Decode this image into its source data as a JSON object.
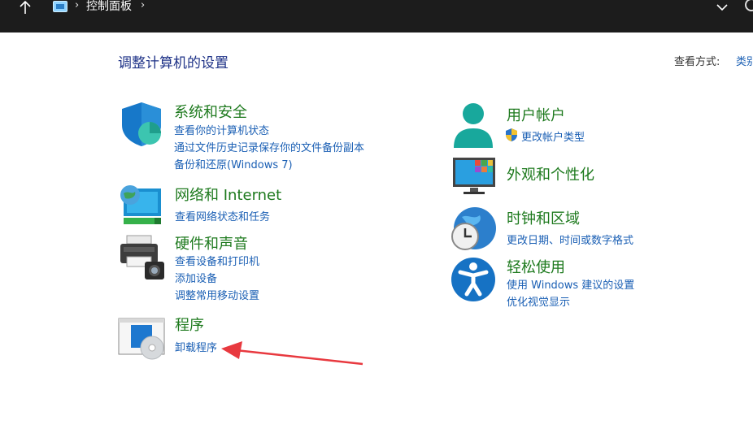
{
  "address_bar": {
    "up_icon": "up-arrow-icon",
    "location_icon": "control-panel-icon",
    "crumb": "控制面板"
  },
  "page": {
    "title": "调整计算机的设置",
    "view_by_label": "查看方式:",
    "view_by_value": "类别"
  },
  "categories": {
    "system": {
      "title": "系统和安全",
      "links": [
        "查看你的计算机状态",
        "通过文件历史记录保存你的文件备份副本",
        "备份和还原(Windows 7)"
      ]
    },
    "network": {
      "title": "网络和 Internet",
      "links": [
        "查看网络状态和任务"
      ]
    },
    "hardware": {
      "title": "硬件和声音",
      "links": [
        "查看设备和打印机",
        "添加设备",
        "调整常用移动设置"
      ]
    },
    "programs": {
      "title": "程序",
      "links": [
        "卸载程序"
      ]
    },
    "users": {
      "title": "用户帐户",
      "links": [
        "更改帐户类型"
      ]
    },
    "appearance": {
      "title": "外观和个性化",
      "links": []
    },
    "clock": {
      "title": "时钟和区域",
      "links": [
        "更改日期、时间或数字格式"
      ]
    },
    "ease": {
      "title": "轻松使用",
      "links": [
        "使用 Windows 建议的设置",
        "优化视觉显示"
      ]
    }
  },
  "colors": {
    "title_green": "#1e7a1e",
    "link_blue": "#1a5fb4",
    "arrow_red": "#e8393f"
  }
}
